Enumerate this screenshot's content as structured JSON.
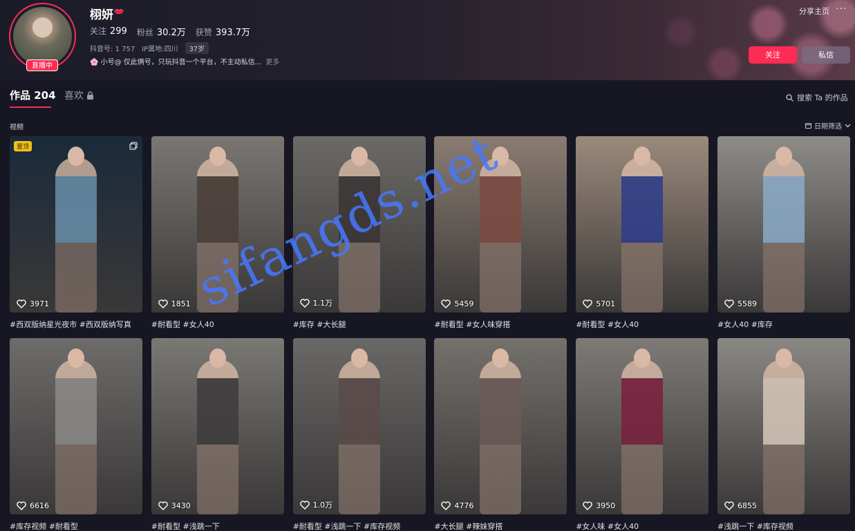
{
  "profile": {
    "nickname": "栩妍",
    "live_badge": "直播中",
    "stats": [
      {
        "label": "关注",
        "value": "299"
      },
      {
        "label": "粉丝",
        "value": "30.2万"
      },
      {
        "label": "获赞",
        "value": "393.7万"
      }
    ],
    "douyin_id_label": "抖音号:",
    "douyin_id_value": "1        757",
    "ip_label": "IP属地:",
    "ip_value": "四川",
    "age": "37岁",
    "bio": "🌸 小号@         仅此俩号，只玩抖音一个平台，不主动私信...",
    "bio_more": "更多"
  },
  "header_actions": {
    "share": "分享主页",
    "more": "···",
    "follow": "关注",
    "message": "私信"
  },
  "tabs": {
    "works": "作品 204",
    "likes": "喜欢"
  },
  "search_placeholder": "搜索 Ta 的作品",
  "section_label": "视频",
  "date_filter": "日期筛选",
  "pin_label": "置顶",
  "videos": [
    {
      "likes": "3971",
      "caption": "#西双版纳星光夜市 #西双版纳写真",
      "bg": "#1a2a3a",
      "accent": "#6a8faa"
    },
    {
      "likes": "1851",
      "caption": "#耐看型 #女人40",
      "bg": "#7a7672",
      "accent": "#4a3e38"
    },
    {
      "likes": "1.1万",
      "caption": "#库存 #大长腿",
      "bg": "#6c6a66",
      "accent": "#3a3434"
    },
    {
      "likes": "5459",
      "caption": "#耐看型 #女人味穿搭",
      "bg": "#8a7c72",
      "accent": "#7c4a40"
    },
    {
      "likes": "5701",
      "caption": "#耐看型 #女人40",
      "bg": "#9b8a7c",
      "accent": "#2c3c8a"
    },
    {
      "likes": "5589",
      "caption": "#女人40 #库存",
      "bg": "#8e8c88",
      "accent": "#8aaac8"
    },
    {
      "likes": "6616",
      "caption": "#库存视频 #耐看型",
      "bg": "#6e6c6a",
      "accent": "#8c8a88"
    },
    {
      "likes": "3430",
      "caption": "#耐看型 #浅跳一下",
      "bg": "#7a7874",
      "accent": "#3c3a3c"
    },
    {
      "likes": "1.0万",
      "caption": "#耐看型 #浅跳一下 #库存视频",
      "bg": "#6a6866",
      "accent": "#5a4a48"
    },
    {
      "likes": "4776",
      "caption": "#大长腿 #辣妹穿搭",
      "bg": "#74706c",
      "accent": "#6a5a56"
    },
    {
      "likes": "3950",
      "caption": "#女人味 #女人40",
      "bg": "#7e7a76",
      "accent": "#7a1e3e"
    },
    {
      "likes": "6855",
      "caption": "#浅跳一下 #库存视频",
      "bg": "#8a8884",
      "accent": "#d6c8b8"
    }
  ],
  "watermark": "sifangds.net"
}
